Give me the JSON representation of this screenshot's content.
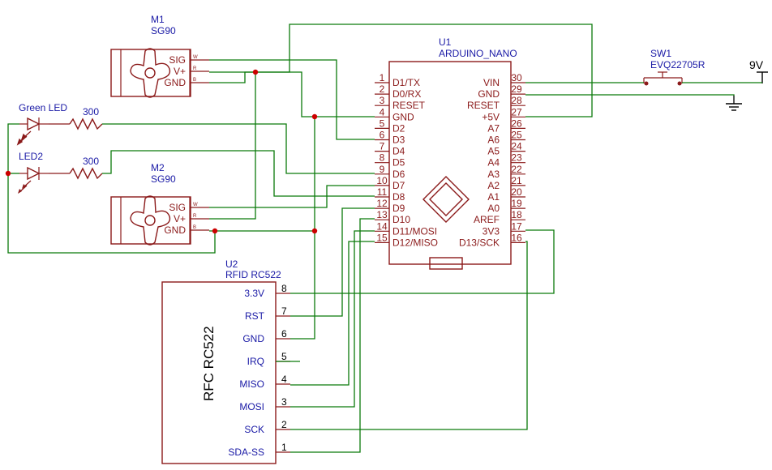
{
  "colors": {
    "wire": "#0a7a0a",
    "component": "#8b1a1a",
    "label": "#1a1aa6",
    "junction": "#cc0000"
  },
  "components": {
    "u1": {
      "ref": "U1",
      "value": "ARDUINO_NANO"
    },
    "u2": {
      "ref": "U2",
      "value": "RFID RC522",
      "body_text": "RFC RC522"
    },
    "m1": {
      "ref": "M1",
      "value": "SG90"
    },
    "m2": {
      "ref": "M2",
      "value": "SG90"
    },
    "sw1": {
      "ref": "SW1",
      "value": "EVQ22705R"
    },
    "led1": {
      "ref": "Green LED"
    },
    "led2": {
      "ref": "LED2"
    },
    "r1": {
      "value": "300"
    },
    "r2": {
      "value": "300"
    },
    "power": {
      "label": "9V"
    }
  },
  "servo_pins": [
    "SIG",
    "V+",
    "GND"
  ],
  "servo_pin_ids": [
    "W",
    "R",
    "B"
  ],
  "nano_left": [
    {
      "num": "1",
      "name": "D1/TX"
    },
    {
      "num": "2",
      "name": "D0/RX"
    },
    {
      "num": "3",
      "name": "RESET"
    },
    {
      "num": "4",
      "name": "GND"
    },
    {
      "num": "5",
      "name": "D2"
    },
    {
      "num": "6",
      "name": "D3"
    },
    {
      "num": "7",
      "name": "D4"
    },
    {
      "num": "8",
      "name": "D5"
    },
    {
      "num": "9",
      "name": "D6"
    },
    {
      "num": "10",
      "name": "D7"
    },
    {
      "num": "11",
      "name": "D8"
    },
    {
      "num": "12",
      "name": "D9"
    },
    {
      "num": "13",
      "name": "D10"
    },
    {
      "num": "14",
      "name": "D11/MOSI"
    },
    {
      "num": "15",
      "name": "D12/MISO"
    }
  ],
  "nano_right": [
    {
      "num": "30",
      "name": "VIN"
    },
    {
      "num": "29",
      "name": "GND"
    },
    {
      "num": "28",
      "name": "RESET"
    },
    {
      "num": "27",
      "name": "+5V"
    },
    {
      "num": "26",
      "name": "A7"
    },
    {
      "num": "25",
      "name": "A6"
    },
    {
      "num": "24",
      "name": "A5"
    },
    {
      "num": "23",
      "name": "A4"
    },
    {
      "num": "22",
      "name": "A3"
    },
    {
      "num": "21",
      "name": "A2"
    },
    {
      "num": "20",
      "name": "A1"
    },
    {
      "num": "19",
      "name": "A0"
    },
    {
      "num": "18",
      "name": "AREF"
    },
    {
      "num": "17",
      "name": "3V3"
    },
    {
      "num": "16",
      "name": "D13/SCK"
    }
  ],
  "rfid_pins": [
    {
      "num": "8",
      "name": "3.3V"
    },
    {
      "num": "7",
      "name": "RST"
    },
    {
      "num": "6",
      "name": "GND"
    },
    {
      "num": "5",
      "name": "IRQ"
    },
    {
      "num": "4",
      "name": "MISO"
    },
    {
      "num": "3",
      "name": "MOSI"
    },
    {
      "num": "2",
      "name": "SCK"
    },
    {
      "num": "1",
      "name": "SDA-SS"
    }
  ]
}
